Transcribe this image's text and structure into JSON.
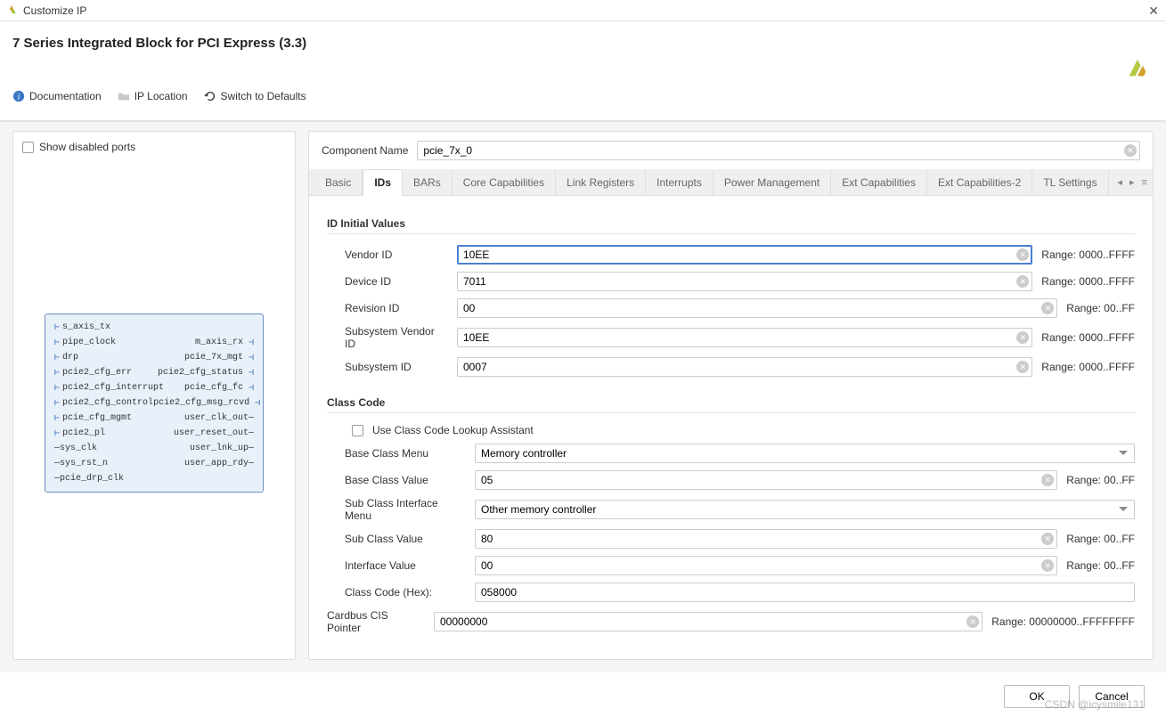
{
  "window": {
    "title": "Customize IP"
  },
  "header": {
    "title": "7 Series Integrated Block for PCI Express (3.3)"
  },
  "toolbar": {
    "documentation": "Documentation",
    "ip_location": "IP Location",
    "switch_defaults": "Switch to Defaults"
  },
  "left": {
    "show_disabled": "Show disabled ports",
    "ports_left": [
      "s_axis_tx",
      "pipe_clock",
      "drp",
      "pcie2_cfg_err",
      "pcie2_cfg_interrupt",
      "pcie2_cfg_control",
      "pcie_cfg_mgmt",
      "pcie2_pl",
      "sys_clk",
      "sys_rst_n",
      "pcie_drp_clk"
    ],
    "ports_right": [
      "",
      "m_axis_rx",
      "pcie_7x_mgt",
      "pcie2_cfg_status",
      "pcie_cfg_fc",
      "pcie2_cfg_msg_rcvd",
      "user_clk_out",
      "user_reset_out",
      "user_lnk_up",
      "user_app_rdy",
      ""
    ]
  },
  "component": {
    "label": "Component Name",
    "value": "pcie_7x_0"
  },
  "tabs": [
    "Basic",
    "IDs",
    "BARs",
    "Core Capabilities",
    "Link Registers",
    "Interrupts",
    "Power Management",
    "Ext Capabilities",
    "Ext Capabilities-2",
    "TL Settings"
  ],
  "active_tab": "IDs",
  "ids": {
    "section": "ID Initial Values",
    "rows": [
      {
        "label": "Vendor ID",
        "value": "10EE",
        "range": "Range: 0000..FFFF",
        "focused": true
      },
      {
        "label": "Device ID",
        "value": "7011",
        "range": "Range: 0000..FFFF"
      },
      {
        "label": "Revision ID",
        "value": "00",
        "range": "Range: 00..FF"
      },
      {
        "label": "Subsystem Vendor ID",
        "value": "10EE",
        "range": "Range: 0000..FFFF"
      },
      {
        "label": "Subsystem ID",
        "value": "0007",
        "range": "Range: 0000..FFFF"
      }
    ]
  },
  "classcode": {
    "section": "Class Code",
    "use_assistant": "Use Class Code Lookup Assistant",
    "base_menu_label": "Base Class Menu",
    "base_menu_value": "Memory controller",
    "base_value_label": "Base Class Value",
    "base_value": "05",
    "base_value_range": "Range: 00..FF",
    "sub_menu_label": "Sub Class Interface Menu",
    "sub_menu_value": "Other memory controller",
    "sub_value_label": "Sub Class Value",
    "sub_value": "80",
    "sub_value_range": "Range: 00..FF",
    "iface_label": "Interface Value",
    "iface_value": "00",
    "iface_range": "Range: 00..FF",
    "hex_label": "Class Code (Hex):",
    "hex_value": "058000",
    "cardbus_label": "Cardbus CIS Pointer",
    "cardbus_value": "00000000",
    "cardbus_range": "Range: 00000000..FFFFFFFF"
  },
  "footer": {
    "ok": "OK",
    "cancel": "Cancel"
  },
  "watermark": "CSDN @icysmile131"
}
